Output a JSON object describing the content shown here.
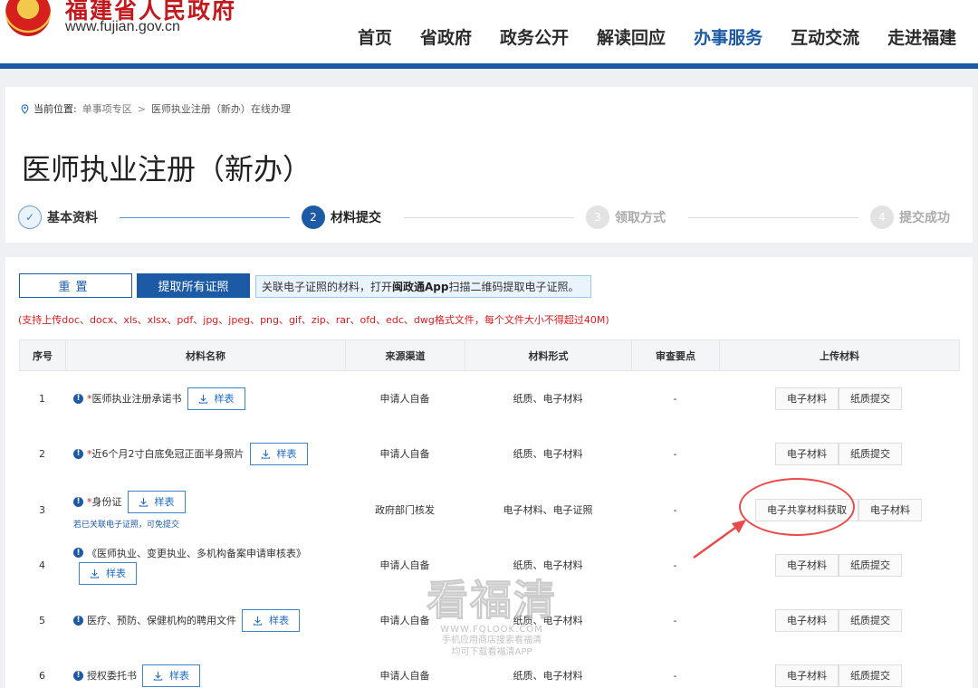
{
  "header": {
    "site_name": "福建省人民政府",
    "site_url": "www.fujian.gov.cn",
    "nav": [
      {
        "label": "首页",
        "active": false
      },
      {
        "label": "省政府",
        "active": false
      },
      {
        "label": "政务公开",
        "active": false
      },
      {
        "label": "解读回应",
        "active": false
      },
      {
        "label": "办事服务",
        "active": true
      },
      {
        "label": "互动交流",
        "active": false
      },
      {
        "label": "走进福建",
        "active": false
      }
    ]
  },
  "breadcrumb": {
    "label": "当前位置:",
    "link": "单事项专区",
    "separator": ">",
    "current": "医师执业注册（新办）在线办理"
  },
  "page_title": "医师执业注册（新办）",
  "steps": [
    {
      "number": "✓",
      "label": "基本资料",
      "state": "done"
    },
    {
      "number": "2",
      "label": "材料提交",
      "state": "active"
    },
    {
      "number": "3",
      "label": "领取方式",
      "state": "todo"
    },
    {
      "number": "4",
      "label": "提交成功",
      "state": "todo"
    }
  ],
  "actions": {
    "reset_label": "重置",
    "fetch_label": "提取所有证照",
    "tip_prefix": "关联电子证照的材料，打开",
    "tip_app": "闽政通App",
    "tip_suffix": "扫描二维码提取电子证照。"
  },
  "format_note": "(支持上传doc、docx、xls、xlsx、pdf、jpg、jpeg、png、gif、zip、rar、ofd、edc、dwg格式文件，每个文件大小不得超过40M)",
  "table": {
    "headers": [
      "序号",
      "材料名称",
      "来源渠道",
      "材料形式",
      "审查要点",
      "上传材料"
    ],
    "sample_label": "样表",
    "rows": [
      {
        "no": "1",
        "required": "*",
        "name": "医师执业注册承诺书",
        "source": "申请人自备",
        "form": "纸质、电子材料",
        "review": "-",
        "uploads": [
          "电子材料",
          "纸质提交"
        ],
        "note": ""
      },
      {
        "no": "2",
        "required": "*",
        "name": "近6个月2寸白底免冠正面半身照片",
        "source": "申请人自备",
        "form": "纸质、电子材料",
        "review": "-",
        "uploads": [
          "电子材料",
          "纸质提交"
        ],
        "note": ""
      },
      {
        "no": "3",
        "required": "*",
        "name": "身份证",
        "source": "政府部门核发",
        "form": "电子材料、电子证照",
        "review": "-",
        "uploads": [
          "电子共享材料获取",
          "电子材料"
        ],
        "note": "若已关联电子证照，可免提交"
      },
      {
        "no": "4",
        "required": "",
        "name": "《医师执业、变更执业、多机构备案申请审核表》",
        "source": "申请人自备",
        "form": "纸质、电子材料",
        "review": "-",
        "uploads": [
          "电子材料",
          "纸质提交"
        ],
        "note": ""
      },
      {
        "no": "5",
        "required": "",
        "name": "医疗、预防、保健机构的聘用文件",
        "source": "申请人自备",
        "form": "纸质、电子材料",
        "review": "-",
        "uploads": [
          "电子材料",
          "纸质提交"
        ],
        "note": ""
      },
      {
        "no": "6",
        "required": "",
        "name": "授权委托书",
        "source": "申请人自备",
        "form": "纸质、电子材料",
        "review": "-",
        "uploads": [
          "电子材料",
          "纸质提交"
        ],
        "note": ""
      }
    ]
  },
  "watermark": {
    "title": "看福清",
    "url": "WWW.FQLOOK.COM",
    "line1": "手机应用商店搜索看福清",
    "line2": "均可下载看福清APP"
  },
  "colors": {
    "primary": "#1d5aa6",
    "required_red": "#e0181c",
    "annotation_red": "#e94b4b"
  }
}
